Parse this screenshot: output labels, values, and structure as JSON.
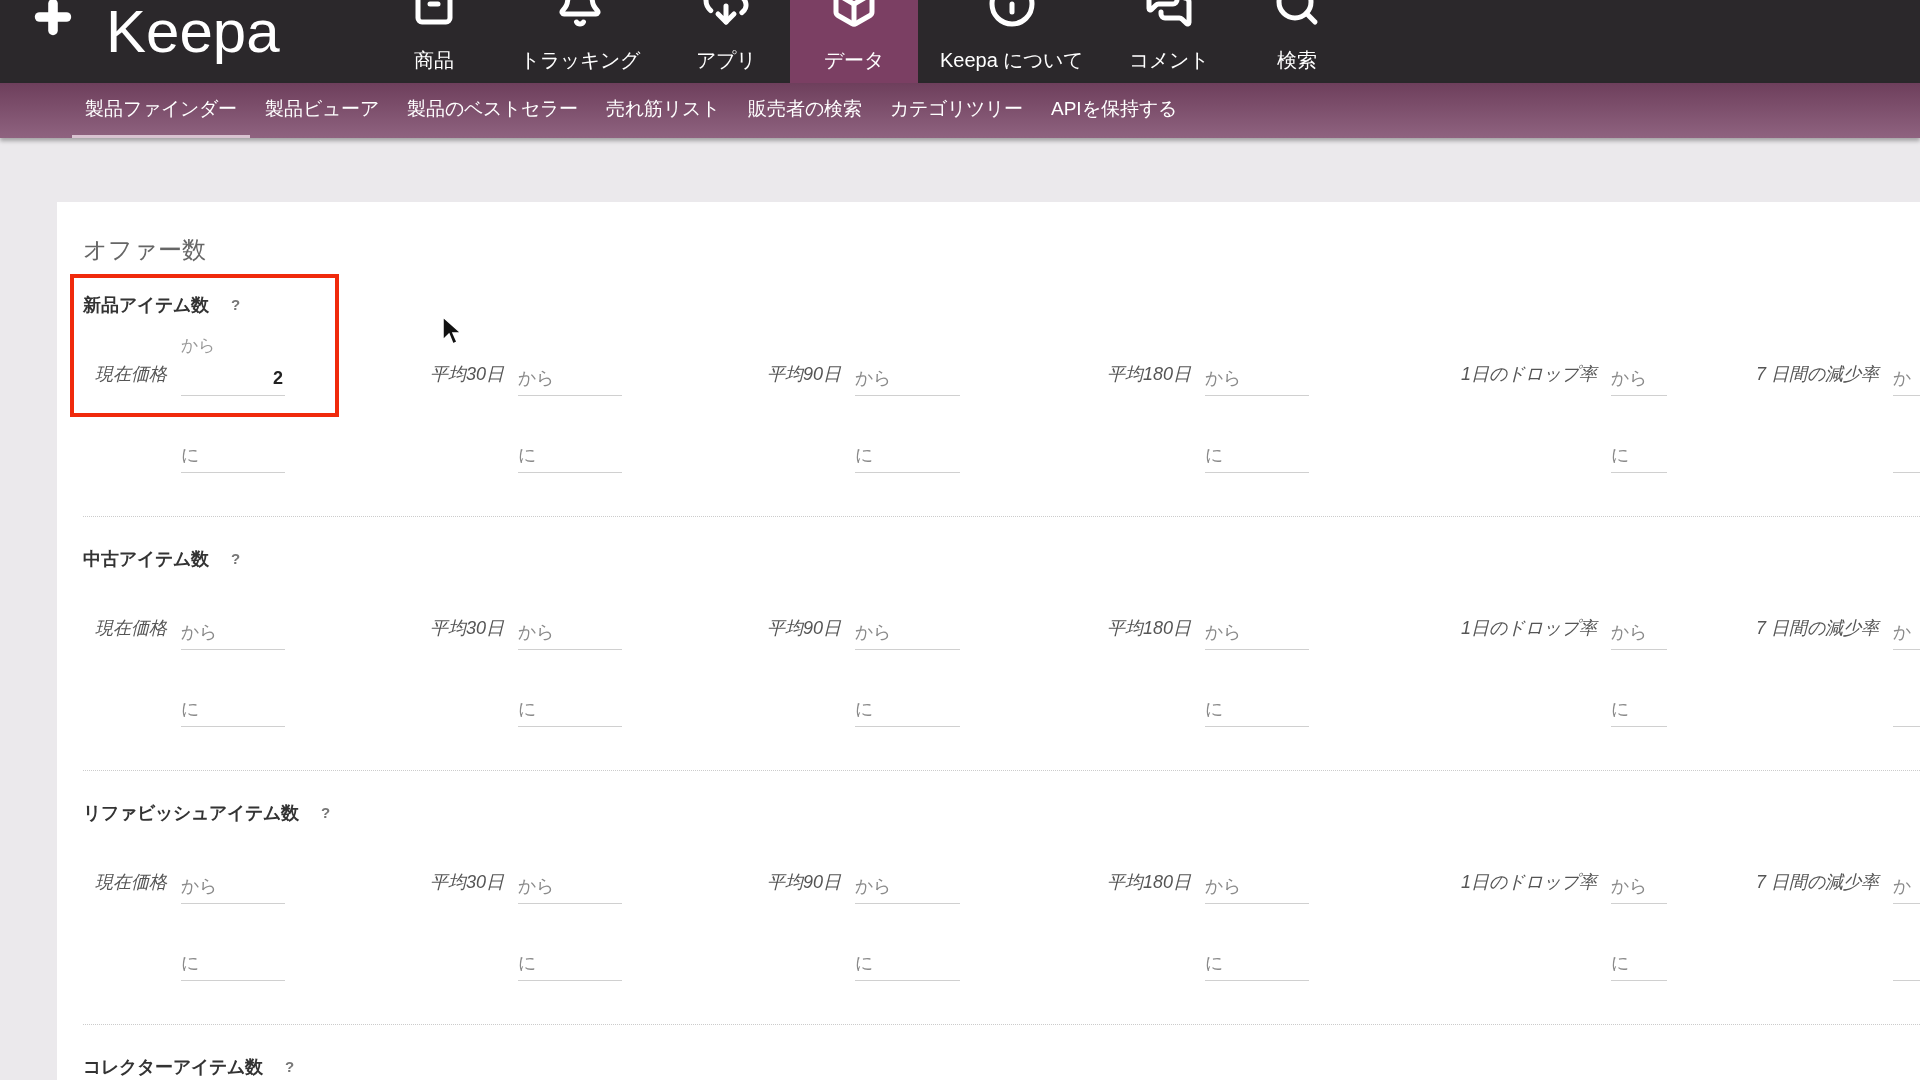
{
  "header": {
    "logo": "Keepa",
    "nav": [
      {
        "label": "商品",
        "selected": false
      },
      {
        "label": "トラッキング",
        "selected": false
      },
      {
        "label": "アプリ",
        "selected": false
      },
      {
        "label": "データ",
        "selected": true
      },
      {
        "label": "Keepa について",
        "selected": false
      },
      {
        "label": "コメント",
        "selected": false
      },
      {
        "label": "検索",
        "selected": false
      }
    ]
  },
  "subnav": [
    {
      "label": "製品ファインダー",
      "selected": true
    },
    {
      "label": "製品ビューア",
      "selected": false
    },
    {
      "label": "製品のベストセラー",
      "selected": false
    },
    {
      "label": "売れ筋リスト",
      "selected": false
    },
    {
      "label": "販売者の検索",
      "selected": false
    },
    {
      "label": "カテゴリツリー",
      "selected": false
    },
    {
      "label": "APIを保持する",
      "selected": false
    }
  ],
  "section_title": "オファー数",
  "groups": [
    {
      "title": "新品アイテム数",
      "help": "?",
      "highlighted": true,
      "columns": [
        {
          "label": "現在価格",
          "from": {
            "placeholder": "から",
            "value": "2"
          },
          "to": {
            "placeholder": "に"
          }
        },
        {
          "label": "平均30日",
          "from": {
            "placeholder": "から"
          },
          "to": {
            "placeholder": "に"
          }
        },
        {
          "label": "平均90日",
          "from": {
            "placeholder": "から"
          },
          "to": {
            "placeholder": "に"
          }
        },
        {
          "label": "平均180日",
          "from": {
            "placeholder": "から"
          },
          "to": {
            "placeholder": "に"
          }
        },
        {
          "label": "1日のドロップ率",
          "from": {
            "placeholder": "から"
          },
          "to": {
            "placeholder": "に"
          }
        },
        {
          "label": "7 日間の減少率",
          "from": {
            "placeholder": "か"
          }
        }
      ]
    },
    {
      "title": "中古アイテム数",
      "help": "?",
      "highlighted": false,
      "columns": [
        {
          "label": "現在価格",
          "from": {
            "placeholder": "から"
          },
          "to": {
            "placeholder": "に"
          }
        },
        {
          "label": "平均30日",
          "from": {
            "placeholder": "から"
          },
          "to": {
            "placeholder": "に"
          }
        },
        {
          "label": "平均90日",
          "from": {
            "placeholder": "から"
          },
          "to": {
            "placeholder": "に"
          }
        },
        {
          "label": "平均180日",
          "from": {
            "placeholder": "から"
          },
          "to": {
            "placeholder": "に"
          }
        },
        {
          "label": "1日のドロップ率",
          "from": {
            "placeholder": "から"
          },
          "to": {
            "placeholder": "に"
          }
        },
        {
          "label": "7 日間の減少率",
          "from": {
            "placeholder": "か"
          }
        }
      ]
    },
    {
      "title": "リファビッシュアイテム数",
      "help": "?",
      "highlighted": false,
      "columns": [
        {
          "label": "現在価格",
          "from": {
            "placeholder": "から"
          },
          "to": {
            "placeholder": "に"
          }
        },
        {
          "label": "平均30日",
          "from": {
            "placeholder": "から"
          },
          "to": {
            "placeholder": "に"
          }
        },
        {
          "label": "平均90日",
          "from": {
            "placeholder": "から"
          },
          "to": {
            "placeholder": "に"
          }
        },
        {
          "label": "平均180日",
          "from": {
            "placeholder": "から"
          },
          "to": {
            "placeholder": "に"
          }
        },
        {
          "label": "1日のドロップ率",
          "from": {
            "placeholder": "から"
          },
          "to": {
            "placeholder": "に"
          }
        },
        {
          "label": "7 日間の減少率",
          "from": {
            "placeholder": "か"
          }
        }
      ]
    },
    {
      "title": "コレクターアイテム数",
      "help": "?",
      "highlighted": false
    }
  ]
}
